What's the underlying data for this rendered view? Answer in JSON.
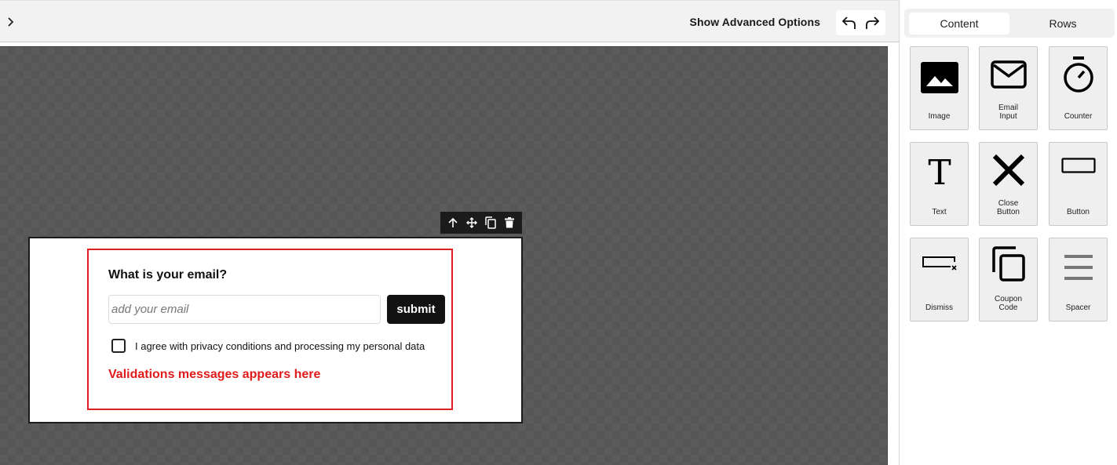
{
  "topbar": {
    "expand_icon": "chevron-right-icon",
    "advanced_options_label": "Show Advanced Options",
    "undo_icon": "undo-icon",
    "redo_icon": "redo-icon"
  },
  "block_toolbar": {
    "icons": [
      "arrow-up-icon",
      "move-icon",
      "duplicate-icon",
      "trash-icon"
    ]
  },
  "form": {
    "title": "What is your email?",
    "email_placeholder": "add your email",
    "email_value": "",
    "submit_label": "submit",
    "consent_label": "I agree with privacy conditions and processing my personal data",
    "consent_checked": false,
    "validation_message": "Validations messages appears here",
    "validation_color": "#e01a1a",
    "frame_color": "#e02020"
  },
  "panel": {
    "tabs": [
      {
        "label": "Content",
        "active": true
      },
      {
        "label": "Rows",
        "active": false
      }
    ],
    "tiles": [
      {
        "label": "Image",
        "icon": "image-icon"
      },
      {
        "label": "Email\nInput",
        "icon": "envelope-icon"
      },
      {
        "label": "Counter",
        "icon": "stopwatch-icon"
      },
      {
        "label": "Text",
        "icon": "text-icon"
      },
      {
        "label": "Close\nButton",
        "icon": "close-icon"
      },
      {
        "label": "Button",
        "icon": "button-icon"
      },
      {
        "label": "Dismiss",
        "icon": "dismiss-icon"
      },
      {
        "label": "Coupon\nCode",
        "icon": "copy-icon"
      },
      {
        "label": "Spacer",
        "icon": "spacer-icon"
      }
    ]
  }
}
